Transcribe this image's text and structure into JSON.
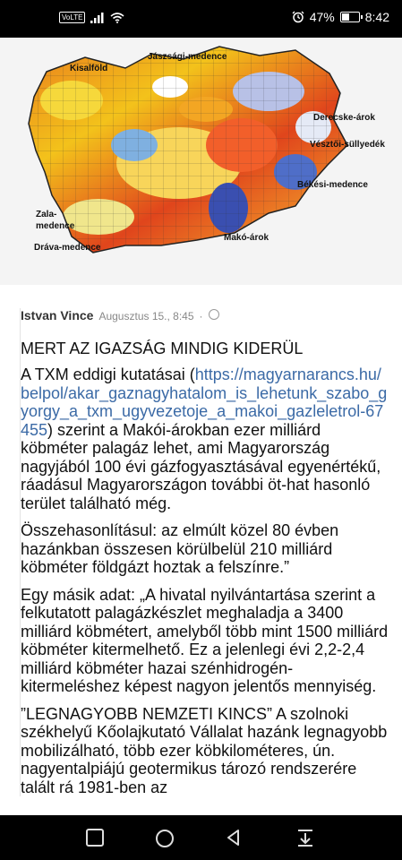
{
  "status_bar": {
    "volte": "VoLTE",
    "battery_percent": "47%",
    "battery_level": 0.47,
    "time": "8:42",
    "icons": [
      "volte-icon",
      "signal-icon",
      "wifi-icon",
      "alarm-icon",
      "battery-icon"
    ]
  },
  "map": {
    "labels": {
      "kisalfold": "Kisalföld",
      "jaszsagi": "Jászsági-medence",
      "derecske": "Derecske-árok",
      "vesztoi": "Vésztői-süllyedék",
      "bekesi": "Békési-medence",
      "zala_1": "Zala-",
      "zala_2": "medence",
      "drava": "Dráva-medence",
      "mako": "Makó-árok"
    }
  },
  "post": {
    "author": "Istvan Vince",
    "timestamp": "Augusztus 15., 8:45",
    "separator": "·",
    "title": "MERT AZ IGAZSÁG MINDIG KIDERÜL",
    "p1_before": "A TXM eddigi kutatásai (",
    "p1_link": "https://magyarnarancs.hu/belpol/akar_gaznagyhatalom_is_lehetunk_szabo_gyorgy_a_txm_ugyvezetoje_a_makoi_gazleletrol-67455",
    "p1_after": ") szerint a Makói-árokban ezer milliárd köbméter palagáz lehet, ami Magyarország nagyjából 100 évi gázfogyasztásával egyenértékű, ráadásul Magyarországon további öt-hat hasonló terület található még.",
    "p2": "Összehasonlításul: az elmúlt közel 80 évben hazánkban összesen körülbelül 210 milliárd köbméter földgázt hoztak a felszínre.”",
    "p3": "Egy másik adat: „A hivatal nyilvántartása szerint a felkutatott palagázkészlet meghaladja a 3400 milliárd köbmétert, amelyből több mint 1500 milliárd köbméter kitermelhető. Ez a jelenlegi évi 2,2-2,4 milliárd köbméter hazai szénhidrogén-kitermeléshez képest nagyon jelentős mennyiség.",
    "p4": "”LEGNAGYOBB NEMZETI KINCS” A szolnoki székhelyű Kőolajkutató Vállalat hazánk legnagyobb mobilizálható, több ezer köbkilométeres, ún. nagyentalpiájú geotermikus tározó rendszerére talált rá 1981-ben az"
  },
  "nav_bar": {
    "buttons": [
      "recent-apps",
      "home",
      "back",
      "notifications-pull-down"
    ]
  }
}
